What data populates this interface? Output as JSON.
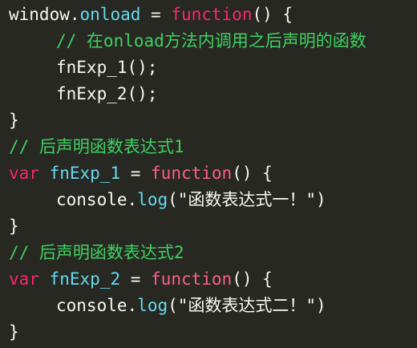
{
  "code": {
    "l1": {
      "obj": "window",
      "dot": ".",
      "prop": "onload",
      "eq": " = ",
      "kw": "function",
      "rest": "() {"
    },
    "l2": {
      "comment": "// 在onload方法内调用之后声明的函数"
    },
    "l3": {
      "call": "fnExp_1",
      "rest": "();"
    },
    "l4": {
      "call": "fnExp_2",
      "rest": "();"
    },
    "l5": {
      "text": "}"
    },
    "l6": {
      "comment": "// 后声明函数表达式1"
    },
    "l7": {
      "kw": "var",
      "name": " fnExp_1",
      "eq": " = ",
      "fn": "function",
      "rest": "() {"
    },
    "l8": {
      "obj": "console",
      "dot": ".",
      "method": "log",
      "args": "(\"函数表达式一！\")"
    },
    "l9": {
      "text": "}"
    },
    "l10": {
      "comment": "// 后声明函数表达式2"
    },
    "l11": {
      "kw": "var",
      "name": " fnExp_2",
      "eq": " = ",
      "fn": "function",
      "rest": "() {"
    },
    "l12": {
      "obj": "console",
      "dot": ".",
      "method": "log",
      "args": "(\"函数表达式二！\")"
    },
    "l13": {
      "text": "}"
    }
  },
  "colors": {
    "background": "#272822",
    "keyword": "#f92672",
    "identifier": "#66d9ef",
    "comment": "#3ed160",
    "plain": "#f8f8f2"
  }
}
